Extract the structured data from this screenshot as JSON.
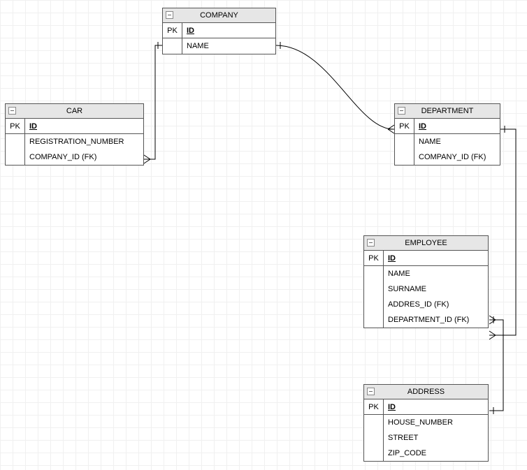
{
  "entities": {
    "company": {
      "title": "COMPANY",
      "pk_label": "PK",
      "pk_field": "ID",
      "attrs": [
        "NAME"
      ]
    },
    "car": {
      "title": "CAR",
      "pk_label": "PK",
      "pk_field": "ID",
      "attrs": [
        "REGISTRATION_NUMBER",
        "COMPANY_ID (FK)"
      ]
    },
    "department": {
      "title": "DEPARTMENT",
      "pk_label": "PK",
      "pk_field": "ID",
      "attrs": [
        "NAME",
        "COMPANY_ID (FK)"
      ]
    },
    "employee": {
      "title": "EMPLOYEE",
      "pk_label": "PK",
      "pk_field": "ID",
      "attrs": [
        "NAME",
        "SURNAME",
        "ADDRES_ID (FK)",
        "DEPARTMENT_ID (FK)"
      ]
    },
    "address": {
      "title": "ADDRESS",
      "pk_label": "PK",
      "pk_field": "ID",
      "attrs": [
        "HOUSE_NUMBER",
        "STREET",
        "ZIP_CODE"
      ]
    }
  },
  "relationships": [
    {
      "from": "company",
      "to": "car",
      "type": "one-to-many"
    },
    {
      "from": "company",
      "to": "department",
      "type": "one-to-many"
    },
    {
      "from": "department",
      "to": "employee",
      "type": "one-to-many"
    },
    {
      "from": "address",
      "to": "employee",
      "type": "one-to-many"
    }
  ]
}
